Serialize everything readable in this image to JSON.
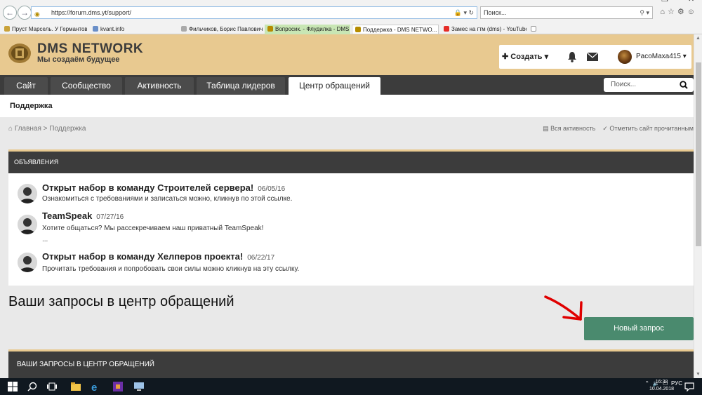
{
  "browser": {
    "url": "https://forum.dms.yt/support/",
    "search_placeholder": "Поиск...",
    "tabs": [
      {
        "label": "Пруст Марсель. У Германтов"
      },
      {
        "label": "kvant.info"
      },
      {
        "label": "Фильчиков, Борис Павлович ..."
      },
      {
        "label": "Вопросик. - Флудилка - DMS ..."
      },
      {
        "label": "Поддержка - DMS NETWO..."
      },
      {
        "label": "Замес на гтм (dms) - YouTube"
      }
    ]
  },
  "site": {
    "logo_title": "DMS NETWORK",
    "logo_slogan": "Мы создаём будущее",
    "create_label": "Создать",
    "username": "PacoMaxa415",
    "nav": [
      "Сайт",
      "Сообщество",
      "Активность",
      "Таблица лидеров",
      "Центр обращений"
    ],
    "search_placeholder": "Поиск...",
    "subnav_label": "Поддержка",
    "breadcrumb": {
      "home": "Главная",
      "sep": ">",
      "current": "Поддержка"
    },
    "actions": {
      "all_activity": "Вся активность",
      "mark_read": "Отметить сайт прочитанным"
    }
  },
  "announcements": {
    "title": "ОБЪЯВЛЕНИЯ",
    "items": [
      {
        "title": "Открыт набор в команду Строителей сервера!",
        "date": "06/05/16",
        "lines": [
          "Ознакомиться с требованиями и записаться можно, кликнув по этой ссылке."
        ]
      },
      {
        "title": "TeamSpeak",
        "date": "07/27/16",
        "lines": [
          "Хотите общаться? Мы рассекречиваем наш приватный TeamSpeak!",
          "..."
        ]
      },
      {
        "title": "Открыт набор в команду Хелперов проекта!",
        "date": "06/22/17",
        "lines": [
          "Прочитать требования и попробовать свои силы можно кликнув на эту ссылку."
        ]
      }
    ]
  },
  "requests": {
    "heading": "Ваши запросы в центр обращений",
    "new_button": "Новый запрос",
    "panel_title": "ВАШИ ЗАПРОСЫ В ЦЕНТР ОБРАЩЕНИЙ"
  },
  "taskbar": {
    "lang": "РУС",
    "time": "16:38",
    "date": "10.04.2018"
  },
  "colors": {
    "accent_gold": "#e8c990",
    "dark_bar": "#3c3c3c",
    "button_green": "#4a8a6e"
  }
}
